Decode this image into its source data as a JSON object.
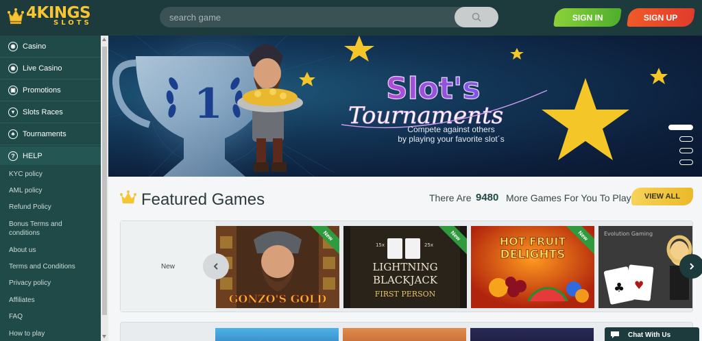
{
  "header": {
    "logo_main": "4KINGS",
    "logo_sub": "SLOTS",
    "search_placeholder": "search game",
    "sign_in": "SIGN IN",
    "sign_up": "SIGN UP"
  },
  "sidebar": {
    "main_items": [
      {
        "label": "Casino",
        "icon": "chip-icon"
      },
      {
        "label": "Live Casino",
        "icon": "live-chip-icon"
      },
      {
        "label": "Promotions",
        "icon": "gift-icon"
      },
      {
        "label": "Slots Races",
        "icon": "trophy-icon"
      },
      {
        "label": "Tournaments",
        "icon": "tournament-icon"
      }
    ],
    "help_label": "HELP",
    "help_items": [
      "KYC policy",
      "AML policy",
      "Refund Policy",
      "Bonus Terms and conditions",
      "About us",
      "Terms and Conditions",
      "Privacy policy",
      "Affiliates",
      "FAQ",
      "How to play"
    ]
  },
  "banner": {
    "title_line1": "Slot's",
    "title_line2": "Tournaments",
    "subtitle_line1": "Compete against others",
    "subtitle_line2": "by playing your favorite slot´s",
    "slides": 4,
    "active_slide": 1
  },
  "featured": {
    "title": "Featured Games",
    "there_are": "There Are",
    "count": "9480",
    "more_text": "More Games For You To Play",
    "view_all": "VIEW ALL",
    "row_label": "New",
    "games": [
      {
        "name": "GONZO'S GOLD",
        "badge": "New"
      },
      {
        "name": "LIGHTNING BLACKJACK",
        "sub": "FIRST PERSON",
        "badge": "New",
        "left_mult": "15x",
        "right_mult": "25x"
      },
      {
        "name": "HOT FRUIT DELIGHTS",
        "badge": "New"
      },
      {
        "name": "Evolution Gaming",
        "badge": ""
      }
    ]
  },
  "chat": {
    "label": "Chat With Us"
  },
  "colors": {
    "header_bg": "#1d3a3c",
    "sidebar_bg": "#1f4a47",
    "accent_gold": "#f7c531",
    "sign_in_green": "#6cc235",
    "sign_up_red": "#e8472a",
    "ribbon_green": "#2f9a3e"
  }
}
